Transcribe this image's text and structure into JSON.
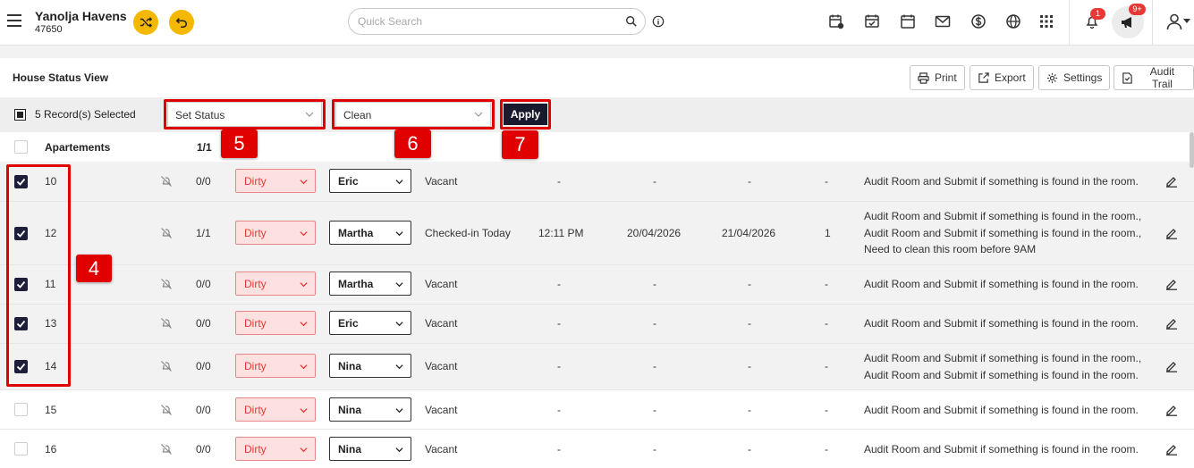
{
  "app": {
    "name": "Yanolja Havens",
    "id": "47650"
  },
  "search": {
    "placeholder": "Quick Search"
  },
  "notifications": {
    "bell_count": "1",
    "announce_count": "9+"
  },
  "page": {
    "title": "House Status View"
  },
  "actions": {
    "print": "Print",
    "export": "Export",
    "settings": "Settings",
    "audit": "Audit Trail"
  },
  "toolbar": {
    "selected_text": "5 Record(s) Selected",
    "status_dd": "Set Status",
    "value_dd": "Clean",
    "apply": "Apply"
  },
  "table": {
    "header_label": "Apartements",
    "header_count": "1/1"
  },
  "rows": [
    {
      "room": "10",
      "count": "0/0",
      "status": "Dirty",
      "staff": "Eric",
      "occupancy": "Vacant",
      "time": "-",
      "arrival": "-",
      "departure": "-",
      "guests": "-",
      "notes": [
        "Audit Room and Submit if something is found in the room."
      ]
    },
    {
      "room": "12",
      "count": "1/1",
      "status": "Dirty",
      "staff": "Martha",
      "occupancy": "Checked-in Today",
      "time": "12:11 PM",
      "arrival": "20/04/2026",
      "departure": "21/04/2026",
      "guests": "1",
      "notes": [
        "Audit Room and Submit if something is found in the room.,",
        "Audit Room and Submit if something is found in the room.,",
        "Need to clean this room before 9AM"
      ]
    },
    {
      "room": "11",
      "count": "0/0",
      "status": "Dirty",
      "staff": "Martha",
      "occupancy": "Vacant",
      "time": "-",
      "arrival": "-",
      "departure": "-",
      "guests": "-",
      "notes": [
        "Audit Room and Submit if something is found in the room."
      ]
    },
    {
      "room": "13",
      "count": "0/0",
      "status": "Dirty",
      "staff": "Eric",
      "occupancy": "Vacant",
      "time": "-",
      "arrival": "-",
      "departure": "-",
      "guests": "-",
      "notes": [
        "Audit Room and Submit if something is found in the room."
      ]
    },
    {
      "room": "14",
      "count": "0/0",
      "status": "Dirty",
      "staff": "Nina",
      "occupancy": "Vacant",
      "time": "-",
      "arrival": "-",
      "departure": "-",
      "guests": "-",
      "notes": [
        "Audit Room and Submit if something is found in the room.,",
        "Audit Room and Submit if something is found in the room."
      ]
    },
    {
      "room": "15",
      "count": "0/0",
      "status": "Dirty",
      "staff": "Nina",
      "occupancy": "Vacant",
      "time": "-",
      "arrival": "-",
      "departure": "-",
      "guests": "-",
      "notes": [
        "Audit Room and Submit if something is found in the room."
      ]
    },
    {
      "room": "16",
      "count": "0/0",
      "status": "Dirty",
      "staff": "Nina",
      "occupancy": "Vacant",
      "time": "-",
      "arrival": "-",
      "departure": "-",
      "guests": "-",
      "notes": [
        "Audit Room and Submit if something is found in the room."
      ]
    }
  ],
  "callouts": {
    "c4": "4",
    "c5": "5",
    "c6": "6",
    "c7": "7"
  },
  "colors": {
    "accent": "#f5b800",
    "highlight": "#e10000",
    "dirty_bg": "#fde0e0",
    "dirty_text": "#e53935",
    "apply_bg": "#1a1a2e"
  }
}
